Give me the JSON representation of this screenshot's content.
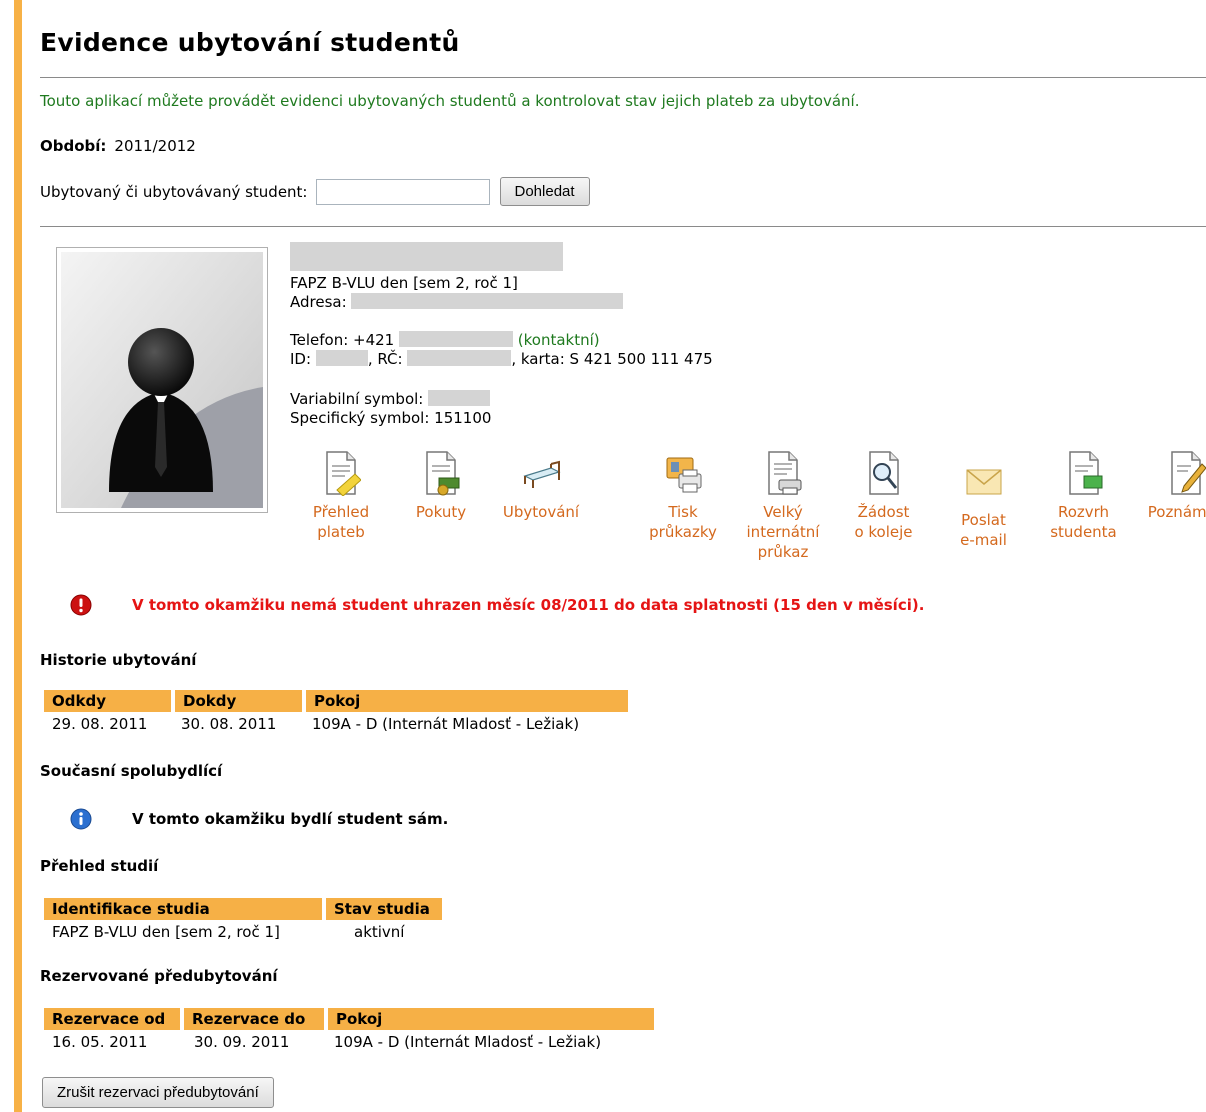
{
  "title": "Evidence ubytování studentů",
  "intro": "Touto aplikací můžete provádět evidenci ubytovaných studentů a kontrolovat stav jejich plateb za ubytování.",
  "period": {
    "label": "Období:",
    "value": "2011/2012"
  },
  "search": {
    "label": "Ubytovaný či ubytovávaný student:",
    "value": "",
    "placeholder": "",
    "button": "Dohledat"
  },
  "student": {
    "study": "FAPZ B-VLU den [sem 2, roč 1]",
    "address_label": "Adresa:",
    "phone_label": "Telefon: +421",
    "phone_note": "(kontaktní)",
    "id_label": "ID:",
    "rc_label": ", RČ:",
    "card": ", karta: S 421 500 111 475",
    "vs_label": "Variabilní symbol:",
    "ss": "Specifický symbol: 151100"
  },
  "actions": [
    {
      "label1": "Přehled",
      "label2": "plateb",
      "label3": "",
      "icon": "payments-icon"
    },
    {
      "label1": "Pokuty",
      "label2": "",
      "label3": "",
      "icon": "fines-icon"
    },
    {
      "label1": "Ubytování",
      "label2": "",
      "label3": "",
      "icon": "bed-icon"
    },
    {
      "label1": "Tisk",
      "label2": "průkazky",
      "label3": "",
      "icon": "print-card-icon"
    },
    {
      "label1": "Velký",
      "label2": "internátní",
      "label3": "průkaz",
      "icon": "print-document-icon"
    },
    {
      "label1": "Žádost",
      "label2": "o koleje",
      "label3": "",
      "icon": "search-document-icon"
    },
    {
      "label1": "Poslat",
      "label2": "e-mail",
      "label3": "",
      "icon": "envelope-icon"
    },
    {
      "label1": "Rozvrh",
      "label2": "studenta",
      "label3": "",
      "icon": "schedule-icon"
    },
    {
      "label1": "Poznámka",
      "label2": "",
      "label3": "",
      "icon": "note-icon"
    }
  ],
  "alerts": {
    "payment": "V tomto okamžiku nemá student uhrazen měsíc 08/2011 do data splatnosti (15 den v měsíci).",
    "roommates": "V tomto okamžiku bydlí student sám."
  },
  "history": {
    "title": "Historie ubytování",
    "headers": [
      "Odkdy",
      "Dokdy",
      "Pokoj"
    ],
    "rows": [
      [
        "29. 08. 2011",
        "30. 08. 2011",
        "109A - D (Internát Mladosť - Ležiak)"
      ]
    ]
  },
  "roommates_title": "Současní spolubydlící",
  "studies": {
    "title": "Přehled studií",
    "headers": [
      "Identifikace studia",
      "Stav studia"
    ],
    "rows": [
      [
        "FAPZ B-VLU den [sem 2, roč 1]",
        "aktivní"
      ]
    ]
  },
  "reservation": {
    "title": "Rezervované předubytování",
    "headers": [
      "Rezervace od",
      "Rezervace do",
      "Pokoj"
    ],
    "rows": [
      [
        "16. 05. 2011",
        "30. 09. 2011",
        "109A - D (Internát Mladosť - Ležiak)"
      ]
    ],
    "cancel_button": "Zrušit rezervaci předubytování"
  },
  "colors": {
    "accent": "#f6b046",
    "link": "#d4691e",
    "intro": "#1f7a1f",
    "alert": "#e51414"
  }
}
